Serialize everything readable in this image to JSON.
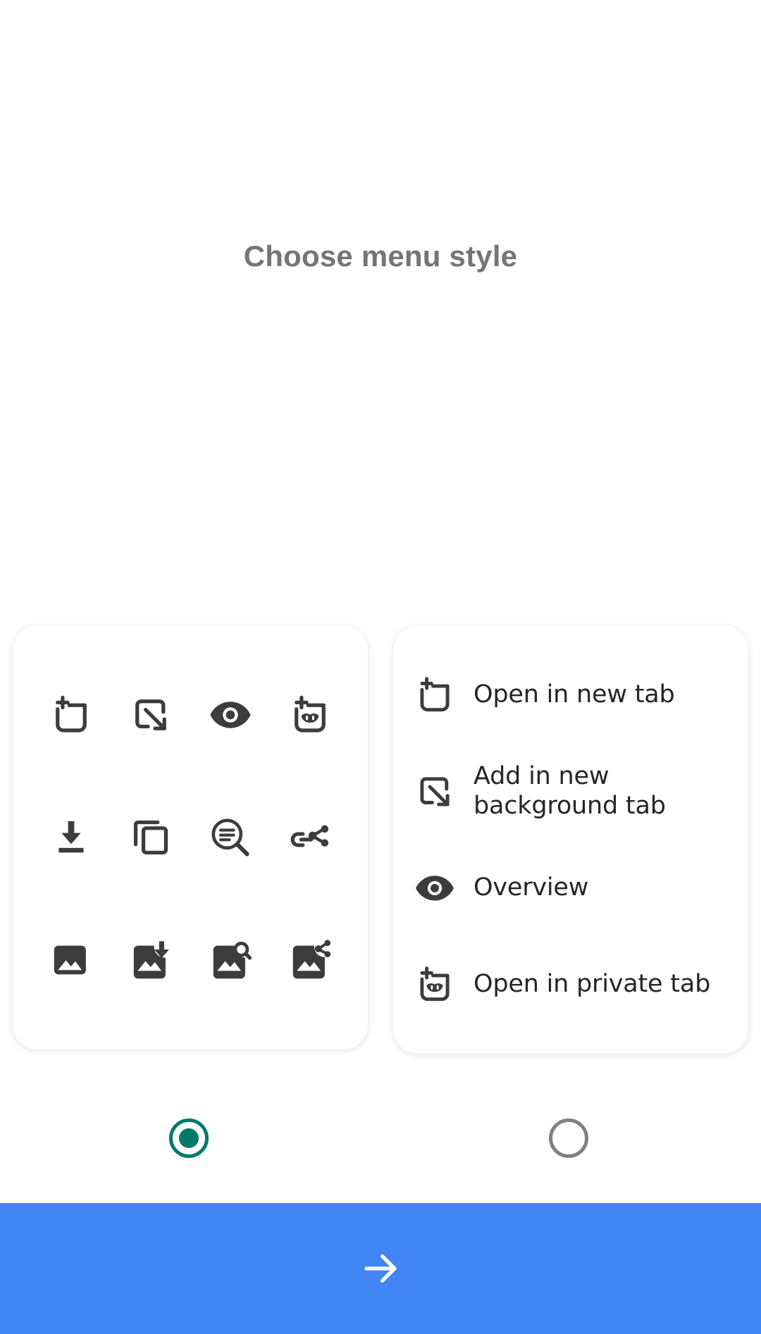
{
  "screen": {
    "title": "Choose menu style",
    "accent_blue": "#4285F4",
    "selected_radio_color": "#00796B",
    "unselected_radio_color": "#808080",
    "title_color": "#757575",
    "icon_color": "#3C3C3C"
  },
  "grid_card": {
    "style_name": "grid",
    "icons": [
      {
        "name": "open-in-new-tab-icon"
      },
      {
        "name": "add-in-new-background-tab-icon"
      },
      {
        "name": "overview-icon"
      },
      {
        "name": "open-in-private-tab-icon"
      },
      {
        "name": "download-icon"
      },
      {
        "name": "copy-icon"
      },
      {
        "name": "find-in-page-icon"
      },
      {
        "name": "share-link-icon"
      },
      {
        "name": "image-icon"
      },
      {
        "name": "image-download-icon"
      },
      {
        "name": "image-search-icon"
      },
      {
        "name": "image-share-icon"
      }
    ]
  },
  "list_card": {
    "style_name": "list",
    "items": [
      {
        "icon": "open-in-new-tab-icon",
        "label": "Open in new tab"
      },
      {
        "icon": "add-in-new-background-tab-icon",
        "label": "Add in new background tab"
      },
      {
        "icon": "overview-icon",
        "label": "Overview"
      },
      {
        "icon": "open-in-private-tab-icon",
        "label": "Open in private tab"
      }
    ]
  },
  "radios": [
    {
      "name": "radio-grid-style",
      "selected": true
    },
    {
      "name": "radio-list-style",
      "selected": false
    }
  ],
  "bottom_bar": {
    "next_icon": "arrow-right-icon"
  }
}
